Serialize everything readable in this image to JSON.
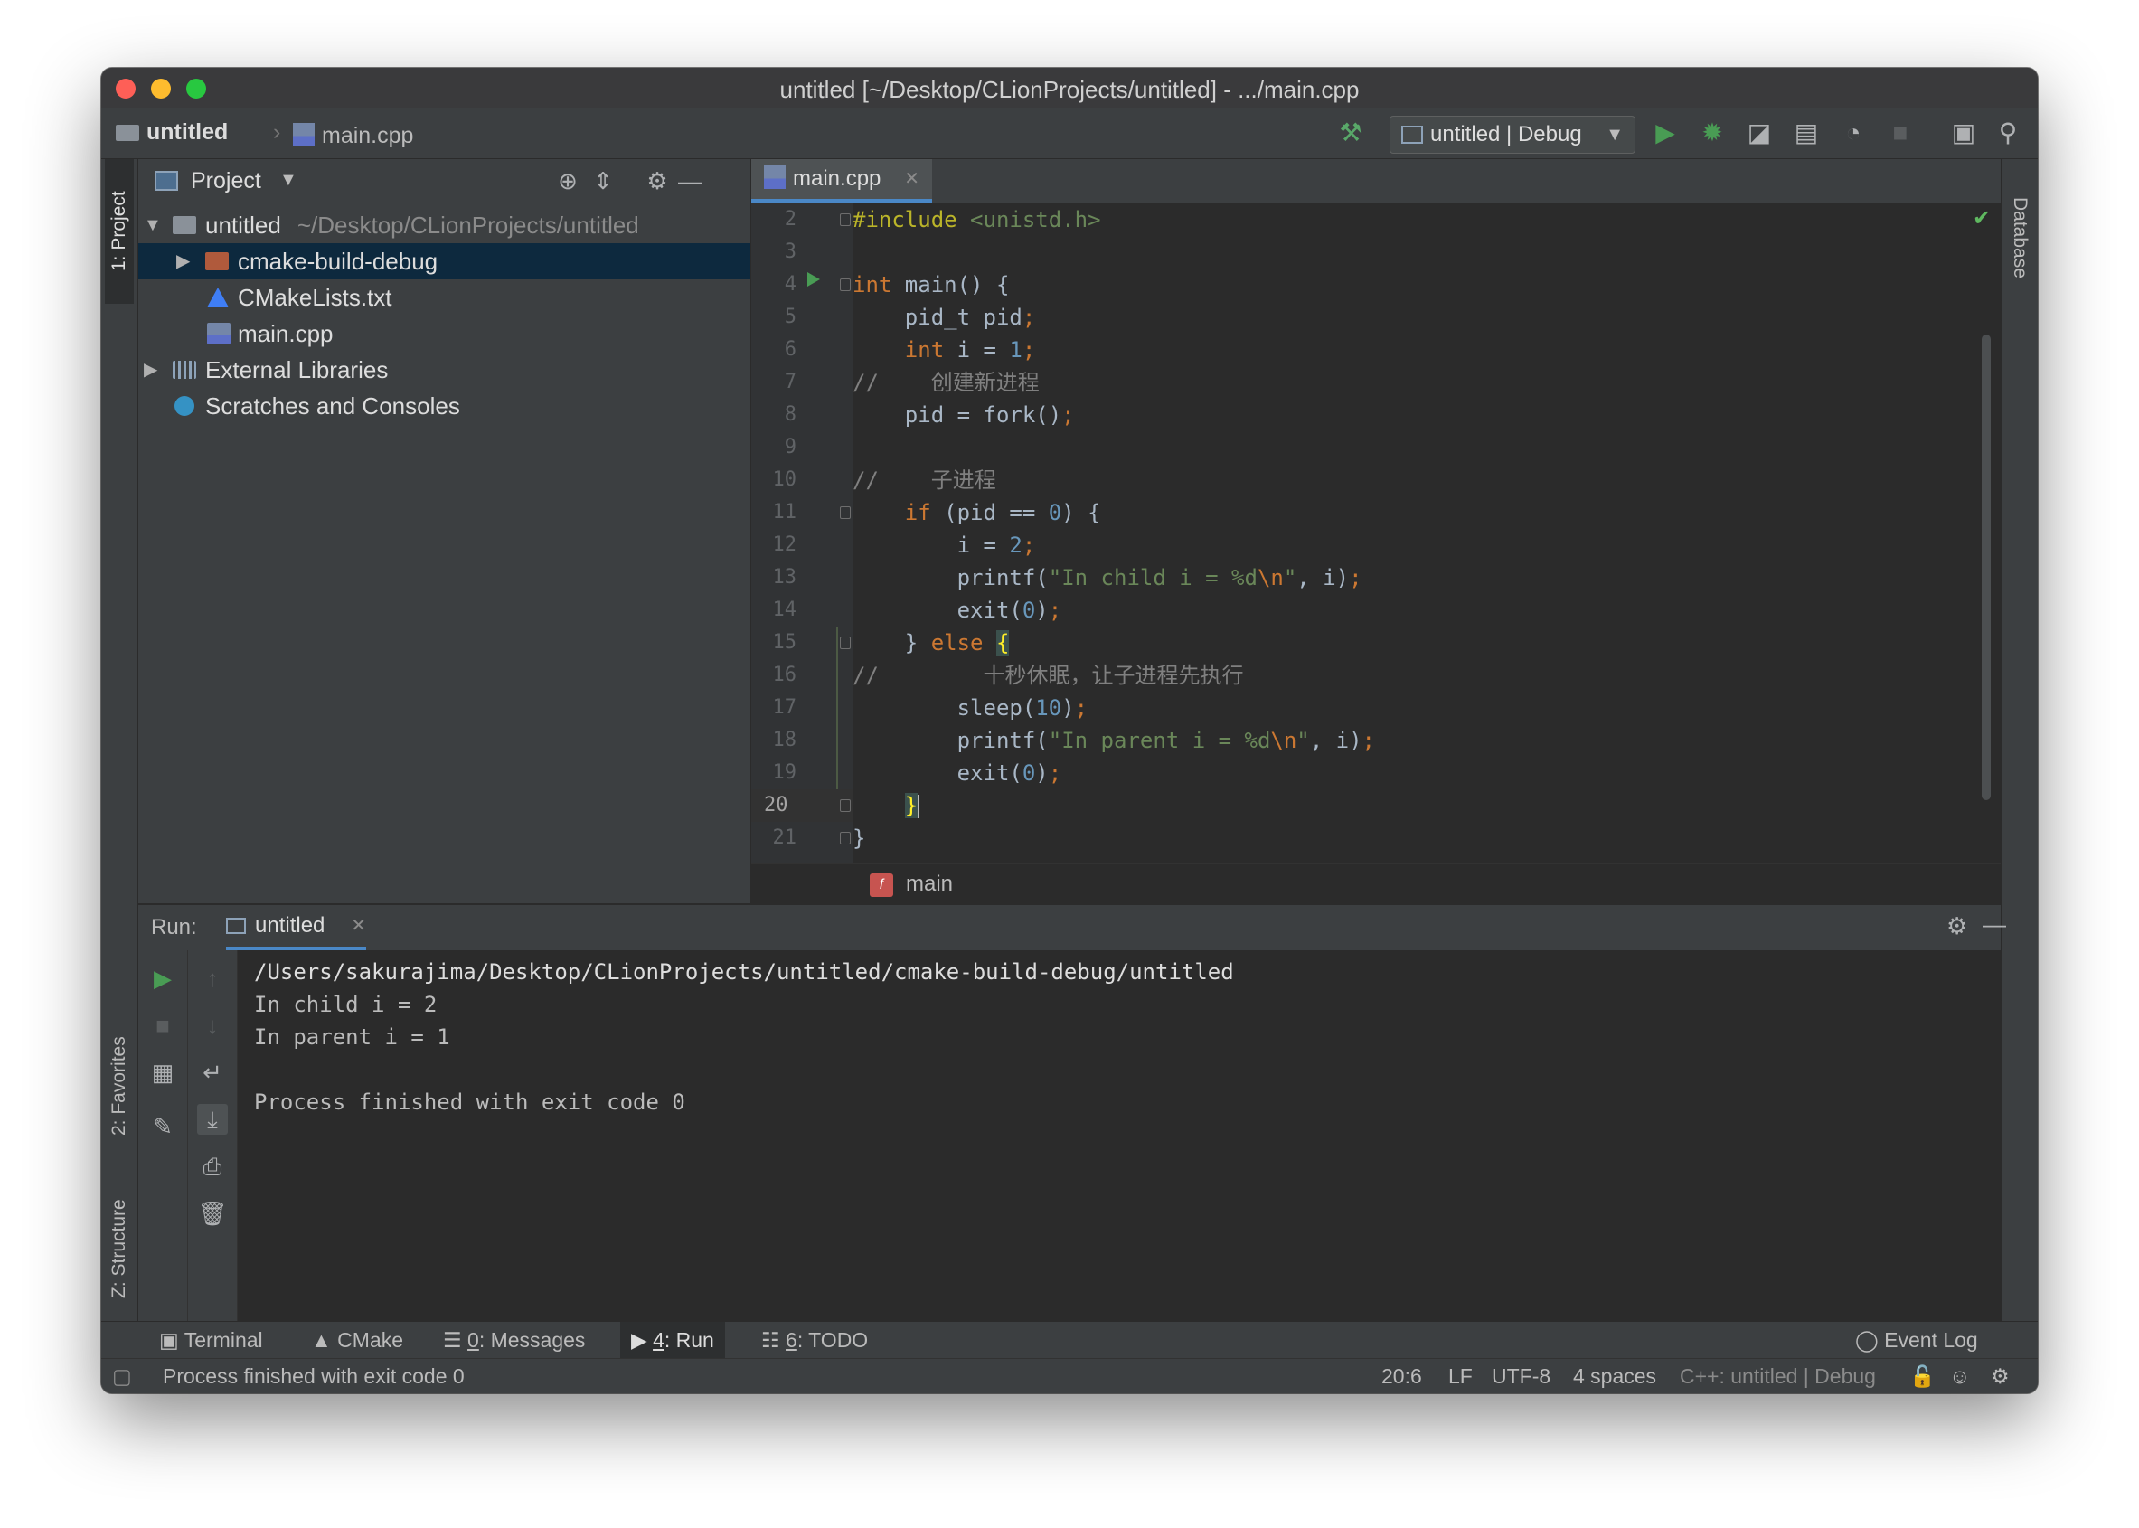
{
  "window": {
    "title": "untitled [~/Desktop/CLionProjects/untitled] - .../main.cpp"
  },
  "navbar": {
    "project": "untitled",
    "file": "main.cpp",
    "run_config": "untitled | Debug"
  },
  "left_stripe": {
    "project_tab": "1: Project",
    "favorites_tab": "2: Favorites",
    "structure_tab": "Z: Structure"
  },
  "right_stripe": {
    "database_tab": "Database"
  },
  "project_panel": {
    "title": "Project",
    "tree": [
      {
        "label": "untitled",
        "path": "~/Desktop/CLionProjects/untitled",
        "icon": "folder-icon"
      },
      {
        "label": "cmake-build-debug",
        "icon": "folder-icon"
      },
      {
        "label": "CMakeLists.txt",
        "icon": "cmake-icon"
      },
      {
        "label": "main.cpp",
        "icon": "cpp-file-icon"
      },
      {
        "label": "External Libraries",
        "icon": "library-icon"
      },
      {
        "label": "Scratches and Consoles",
        "icon": "scratches-icon"
      }
    ]
  },
  "editor": {
    "tab": "main.cpp",
    "current_line": "20",
    "lines": [
      {
        "n": "2"
      },
      {
        "n": "3"
      },
      {
        "n": "4"
      },
      {
        "n": "5"
      },
      {
        "n": "6"
      },
      {
        "n": "7"
      },
      {
        "n": "8"
      },
      {
        "n": "9"
      },
      {
        "n": "10"
      },
      {
        "n": "11"
      },
      {
        "n": "12"
      },
      {
        "n": "13"
      },
      {
        "n": "14"
      },
      {
        "n": "15"
      },
      {
        "n": "16"
      },
      {
        "n": "17"
      },
      {
        "n": "18"
      },
      {
        "n": "19"
      },
      {
        "n": "20"
      },
      {
        "n": "21"
      }
    ],
    "code": {
      "l2_directive": "#include",
      "l2_header": " <unistd.h>",
      "l4_kw": "int",
      "l4_rest": " main() {",
      "l5": "    pid_t pid",
      "l5_semi": ";",
      "l6_kw": "    int",
      "l6_mid": " i = ",
      "l6_num": "1",
      "l6_semi": ";",
      "l7": "//    创建新进程",
      "l8": "    pid = fork()",
      "l8_semi": ";",
      "l10": "//    子进程",
      "l11_kw": "    if",
      "l11_a": " (pid == ",
      "l11_num": "0",
      "l11_b": ") {",
      "l12_a": "        i = ",
      "l12_num": "2",
      "l12_semi": ";",
      "l13_a": "        printf(",
      "l13_str1": "\"In child i = %d",
      "l13_esc": "\\n",
      "l13_str2": "\"",
      "l13_b": ", i)",
      "l13_semi": ";",
      "l14_a": "        exit(",
      "l14_num": "0",
      "l14_b": ")",
      "l14_semi": ";",
      "l15_a": "    } ",
      "l15_kw": "else",
      "l15_b": " ",
      "l15_brace": "{",
      "l16": "//        十秒休眠，让子进程先执行",
      "l17_a": "        sleep(",
      "l17_num": "10",
      "l17_b": ")",
      "l17_semi": ";",
      "l18_a": "        printf(",
      "l18_str1": "\"In parent i = %d",
      "l18_esc": "\\n",
      "l18_str2": "\"",
      "l18_b": ", i)",
      "l18_semi": ";",
      "l19_a": "        exit(",
      "l19_num": "0",
      "l19_b": ")",
      "l19_semi": ";",
      "l20_pad": "    ",
      "l20_brace": "}",
      "l21": "}"
    },
    "breadcrumb_fn": "main",
    "fn_badge": "f"
  },
  "run": {
    "label": "Run:",
    "tab": "untitled",
    "output": [
      "/Users/sakurajima/Desktop/CLionProjects/untitled/cmake-build-debug/untitled",
      "In child i = 2",
      "In parent i = 1",
      "",
      "Process finished with exit code 0"
    ]
  },
  "bottom_tabs": {
    "terminal": "Terminal",
    "cmake": "CMake",
    "messages_num": "0",
    "messages": ": Messages",
    "run_num": "4",
    "run": ": Run",
    "todo_num": "6",
    "todo": ": TODO",
    "event_log": "Event Log"
  },
  "status": {
    "message": "Process finished with exit code 0",
    "position": "20:6",
    "line_sep": "LF",
    "encoding": "UTF-8",
    "indent": "4 spaces",
    "context": "C++: untitled | Debug"
  },
  "colors": {
    "accent": "#4a88c7",
    "run_green": "#499c54",
    "keyword": "#cc7832",
    "string": "#6a8759",
    "number": "#6897bb"
  }
}
